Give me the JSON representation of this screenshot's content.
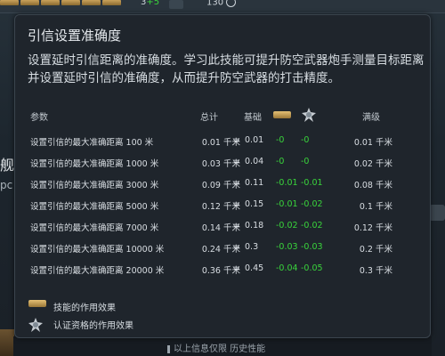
{
  "tooltip": {
    "title": "引信设置准确度",
    "description": "设置延时引信距离的准确度。学习此技能可提升防空武器炮手测量目标距离并设置延时引信的准确度，从而提升防空武器的打击精度。",
    "headers": {
      "param": "参数",
      "total": "总计",
      "base": "基础",
      "full": "满级"
    },
    "rows": [
      {
        "param": "设置引信的最大准确距离 100 米",
        "total": "0.01 千米",
        "eq": "=",
        "base": "0.01",
        "skill": "-0",
        "cert": "-0",
        "full": "0.01 千米"
      },
      {
        "param": "设置引信的最大准确距离 1000 米",
        "total": "0.03 千米",
        "eq": "=",
        "base": "0.04",
        "skill": "-0",
        "cert": "-0",
        "full": "0.02 千米"
      },
      {
        "param": "设置引信的最大准确距离 3000 米",
        "total": "0.09 千米",
        "eq": "=",
        "base": "0.11",
        "skill": "-0.01",
        "cert": "-0.01",
        "full": "0.08 千米"
      },
      {
        "param": "设置引信的最大准确距离 5000 米",
        "total": "0.12 千米",
        "eq": "=",
        "base": "0.15",
        "skill": "-0.01",
        "cert": "-0.02",
        "full": "0.1 千米"
      },
      {
        "param": "设置引信的最大准确距离 7000 米",
        "total": "0.14 千米",
        "eq": "=",
        "base": "0.18",
        "skill": "-0.02",
        "cert": "-0.02",
        "full": "0.12 千米"
      },
      {
        "param": "设置引信的最大准确距离 10000 米",
        "total": "0.24 千米",
        "eq": "=",
        "base": "0.3",
        "skill": "-0.03",
        "cert": "-0.03",
        "full": "0.2 千米"
      },
      {
        "param": "设置引信的最大准确距离 20000 米",
        "total": "0.36 千米",
        "eq": "=",
        "base": "0.45",
        "skill": "-0.04",
        "cert": "-0.05",
        "full": "0.3 千米"
      }
    ],
    "legend": {
      "skill_label": "技能的作用效果",
      "cert_label": "认证资格的作用效果"
    },
    "footer": "以上信息仅限 历史性能"
  },
  "topbar": {
    "counter_a": "3",
    "counter_a_plus": "+5",
    "counter_b": "130"
  },
  "side": {
    "left_char": "舰",
    "left_sub": "pc"
  },
  "colors": {
    "effect_green": "#39d43b",
    "skill_gold": "#e4c074"
  }
}
